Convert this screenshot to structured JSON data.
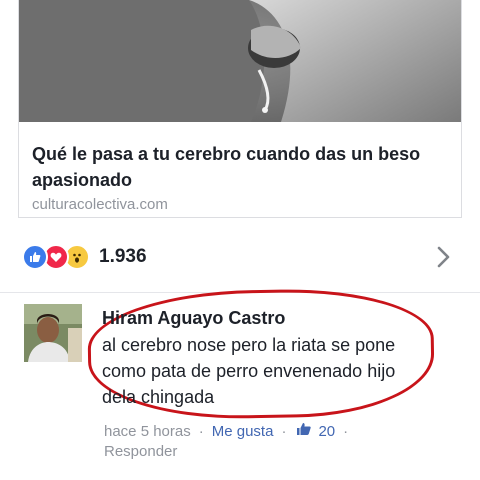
{
  "article": {
    "headline": "Qué le pasa a tu cerebro cuando das un beso apasionado",
    "domain": "culturacolectiva.com"
  },
  "reactions": {
    "count": "1.936",
    "icons": [
      "like-icon",
      "love-icon",
      "wow-icon"
    ],
    "colors": {
      "like": "#3b7bea",
      "love": "#f0284a",
      "wow": "#f7c940"
    }
  },
  "comment": {
    "author": "Hiram Aguayo Castro",
    "text": "al cerebro nose pero la riata se pone como pata de perro envenenado hijo dela chingada",
    "time": "hace 5 horas",
    "like_label": "Me gusta",
    "like_count": "20",
    "reply_label": "Responder",
    "highlight_color": "#c8141a"
  }
}
